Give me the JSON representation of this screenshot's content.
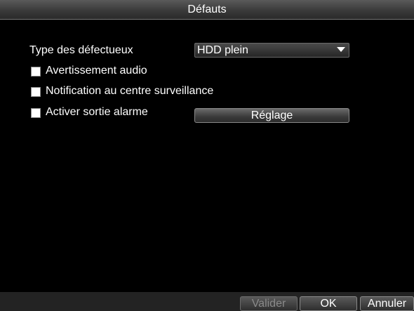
{
  "title": "Défauts",
  "fields": {
    "type_label": "Type des défectueux",
    "type_value": "HDD plein",
    "options": [
      {
        "label": "Avertissement audio",
        "checked": false
      },
      {
        "label": "Notification au centre surveillance",
        "checked": false
      },
      {
        "label": "Activer sortie alarme",
        "checked": false
      }
    ],
    "setup_label": "Réglage"
  },
  "footer": {
    "apply_label": "Valider",
    "ok_label": "OK",
    "cancel_label": "Annuler"
  },
  "icons": {
    "dropdown": "chevron-down-icon"
  }
}
